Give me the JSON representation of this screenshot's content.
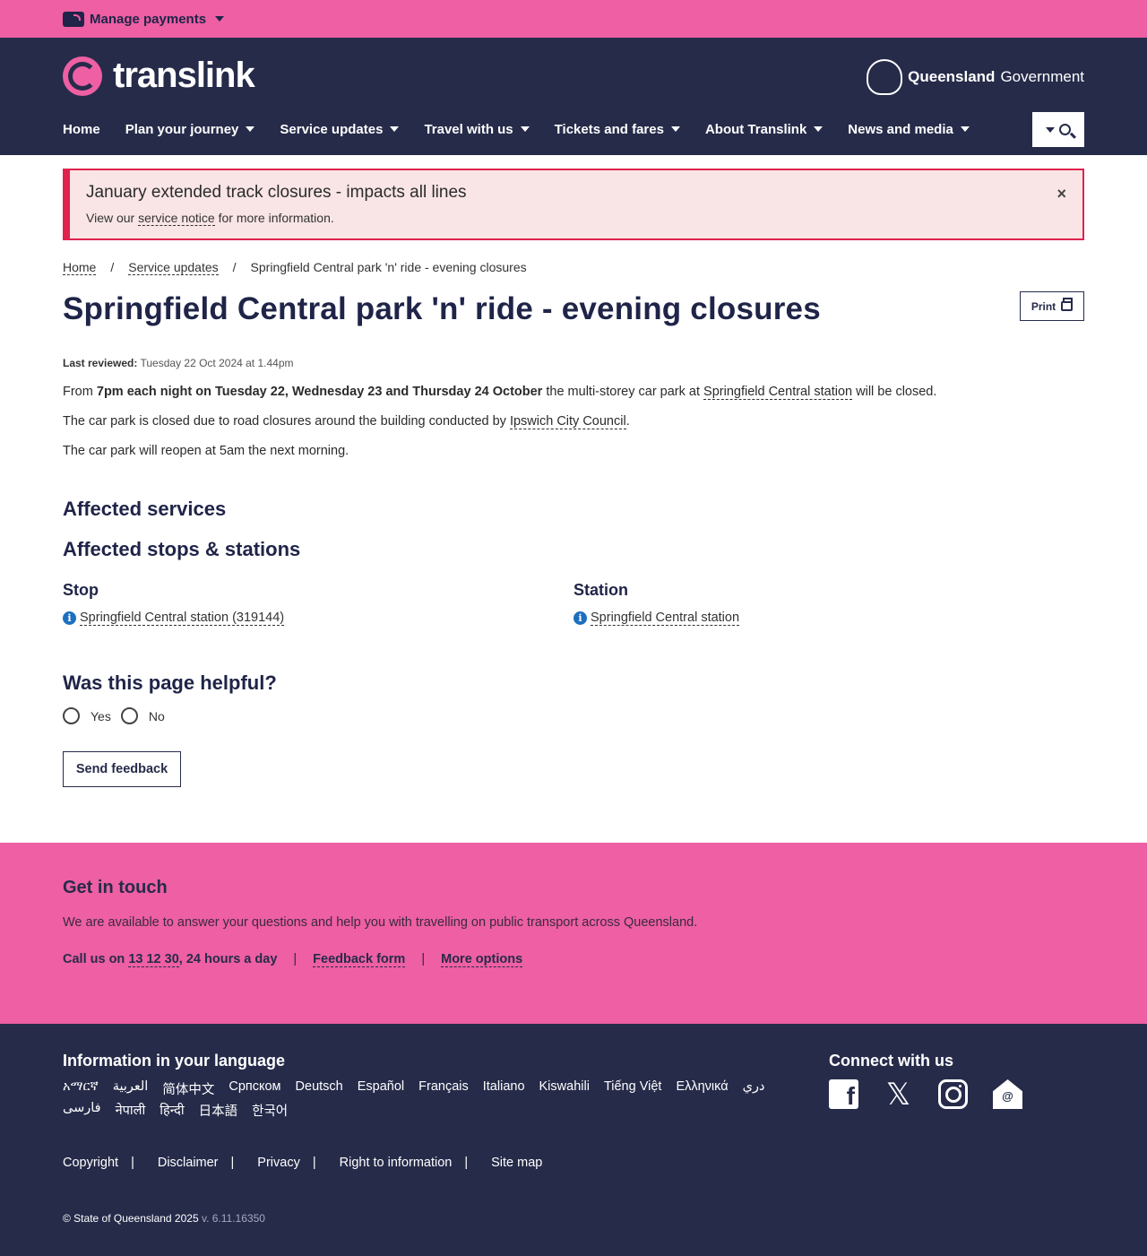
{
  "topbar": {
    "manage_payments": "Manage payments"
  },
  "header": {
    "logo_text": "translink",
    "gov_bold": "Queensland",
    "gov_regular": "Government",
    "nav": [
      {
        "label": "Home",
        "dropdown": false
      },
      {
        "label": "Plan your journey",
        "dropdown": true
      },
      {
        "label": "Service updates",
        "dropdown": true
      },
      {
        "label": "Travel with us",
        "dropdown": true
      },
      {
        "label": "Tickets and fares",
        "dropdown": true
      },
      {
        "label": "About Translink",
        "dropdown": true
      },
      {
        "label": "News and media",
        "dropdown": true
      }
    ]
  },
  "alert": {
    "title": "January extended track closures - impacts all lines",
    "body_prefix": "View our",
    "body_link": "service notice",
    "body_suffix": "for more information.",
    "close": "×"
  },
  "breadcrumb": {
    "home": "Home",
    "service_updates": "Service updates",
    "current": "Springfield Central park 'n' ride - evening closures",
    "separator": "/"
  },
  "page": {
    "title": "Springfield Central park 'n' ride - evening closures",
    "print_label": "Print",
    "last_reviewed_label": "Last reviewed:",
    "last_reviewed_value": "Tuesday 22 Oct 2024 at 1.44pm",
    "p1_from": "From",
    "p1_bold": "7pm each night on Tuesday 22, Wednesday 23 and Thursday 24 October",
    "p1_mid": "the multi-storey car park at",
    "p1_link": "Springfield Central station",
    "p1_end": "will be closed.",
    "p2_text": "The car park is closed due to road closures around the building conducted by",
    "p2_link": "Ipswich City Council",
    "p2_end": ".",
    "p3_text": "The car park will reopen at 5am the next morning.",
    "affected_services": "Affected services",
    "affected_stops": "Affected stops & stations",
    "stop_heading": "Stop",
    "stop_link": "Springfield Central station (319144)",
    "station_heading": "Station",
    "station_link": "Springfield Central station",
    "helpful_heading": "Was this page helpful?",
    "yes": "Yes",
    "no": "No",
    "send_feedback": "Send feedback"
  },
  "touch": {
    "heading": "Get in touch",
    "text": "We are available to answer your questions and help you with travelling on public transport across Queensland.",
    "call_prefix": "Call us on",
    "call_number": "13 12 30",
    "call_suffix": ", 24 hours a day",
    "feedback_form": "Feedback form",
    "more_options": "More options",
    "separator": "|"
  },
  "footer": {
    "lang_heading": "Information in your language",
    "languages": [
      "አማርኛ",
      "العربية",
      "简体中文",
      "Српском",
      "Deutsch",
      "Español",
      "Français",
      "Italiano",
      "Kiswahili",
      "Tiếng Việt",
      "Ελληνικά",
      "دري",
      "فارسی",
      "नेपाली",
      "हिन्दी",
      "日本語",
      "한국어"
    ],
    "connect_heading": "Connect with us",
    "links": [
      "Copyright",
      "Disclaimer",
      "Privacy",
      "Right to information",
      "Site map"
    ],
    "copyright": "© State of Queensland 2025",
    "version": "v. 6.11.16350"
  },
  "colors": {
    "pink": "#ee5fa3",
    "navy": "#262b4a",
    "alert_red": "#e0224d"
  }
}
